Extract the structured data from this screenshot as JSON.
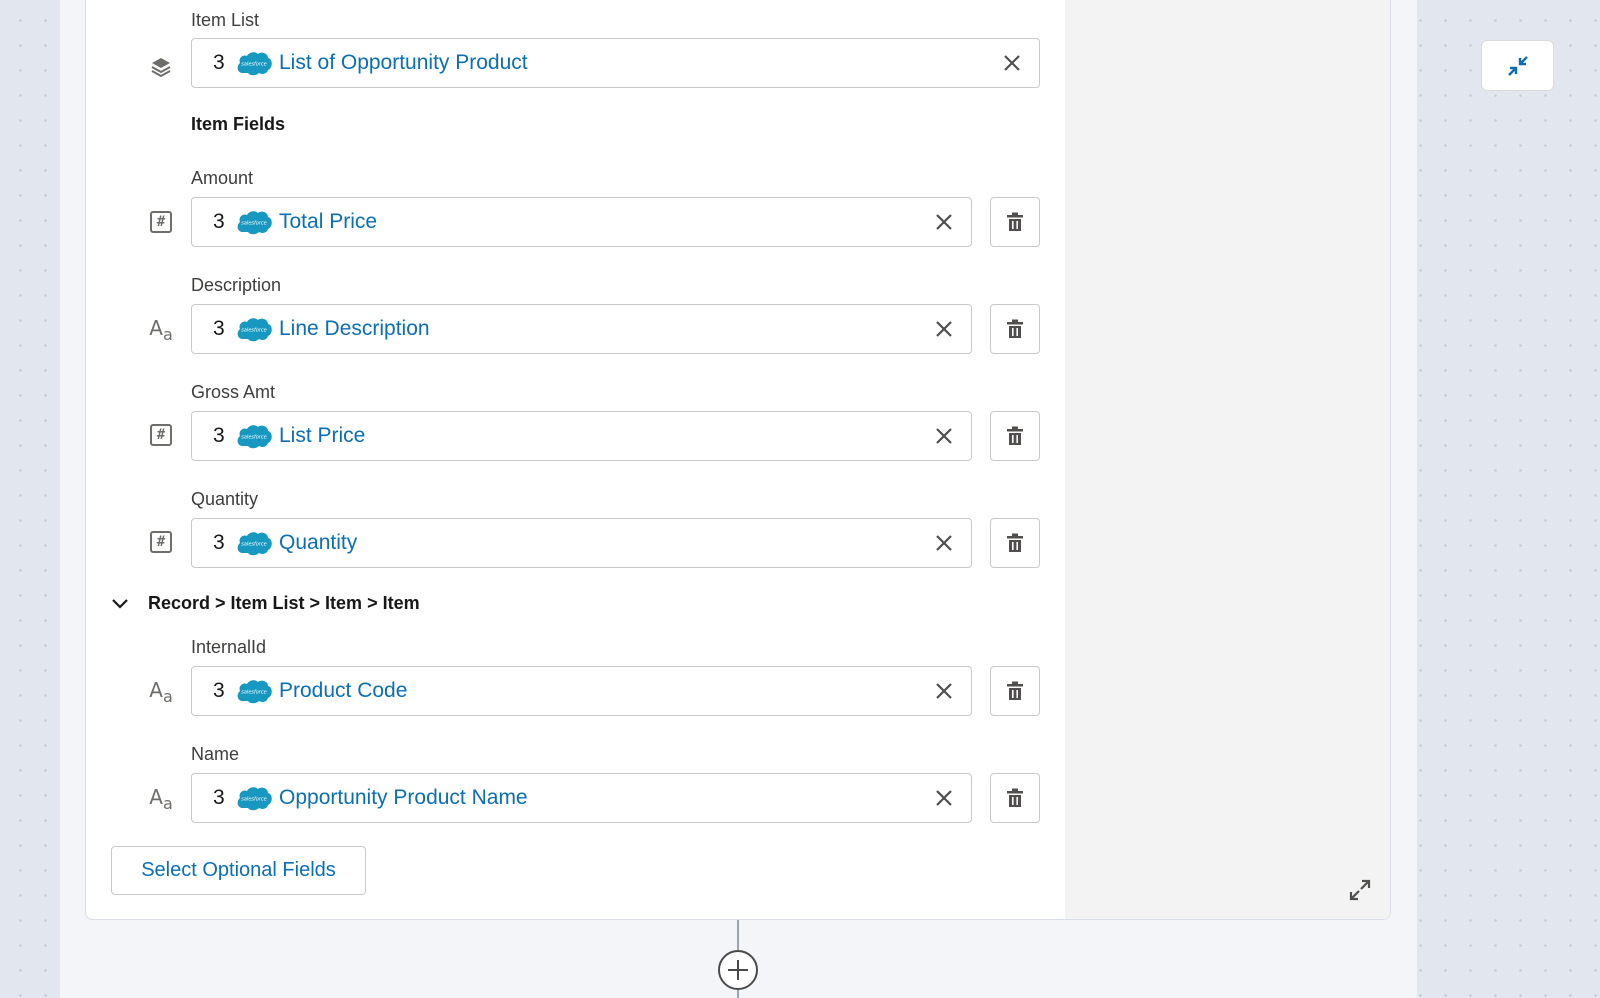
{
  "item_list": {
    "label": "Item List",
    "icon": "layers-icon",
    "step": "3",
    "value": "List of Opportunity Product"
  },
  "item_fields_title": "Item Fields",
  "fields": [
    {
      "label": "Amount",
      "icon": "number-icon",
      "step": "3",
      "value": "Total Price"
    },
    {
      "label": "Description",
      "icon": "text-icon",
      "step": "3",
      "value": "Line Description"
    },
    {
      "label": "Gross Amt",
      "icon": "number-icon",
      "step": "3",
      "value": "List Price"
    },
    {
      "label": "Quantity",
      "icon": "number-icon",
      "step": "3",
      "value": "Quantity"
    }
  ],
  "subsection": {
    "breadcrumb": "Record > Item List > Item > Item",
    "fields": [
      {
        "label": "InternalId",
        "icon": "text-icon",
        "step": "3",
        "value": "Product Code"
      },
      {
        "label": "Name",
        "icon": "text-icon",
        "step": "3",
        "value": "Opportunity Product Name"
      }
    ]
  },
  "optional_fields_button": "Select Optional Fields",
  "app_logo_text": "salesforce",
  "colors": {
    "link_blue": "#0b6fb5",
    "salesforce_blue": "#1798c1",
    "canvas": "#e1e6ef",
    "panel_gray": "#f3f3f3"
  }
}
